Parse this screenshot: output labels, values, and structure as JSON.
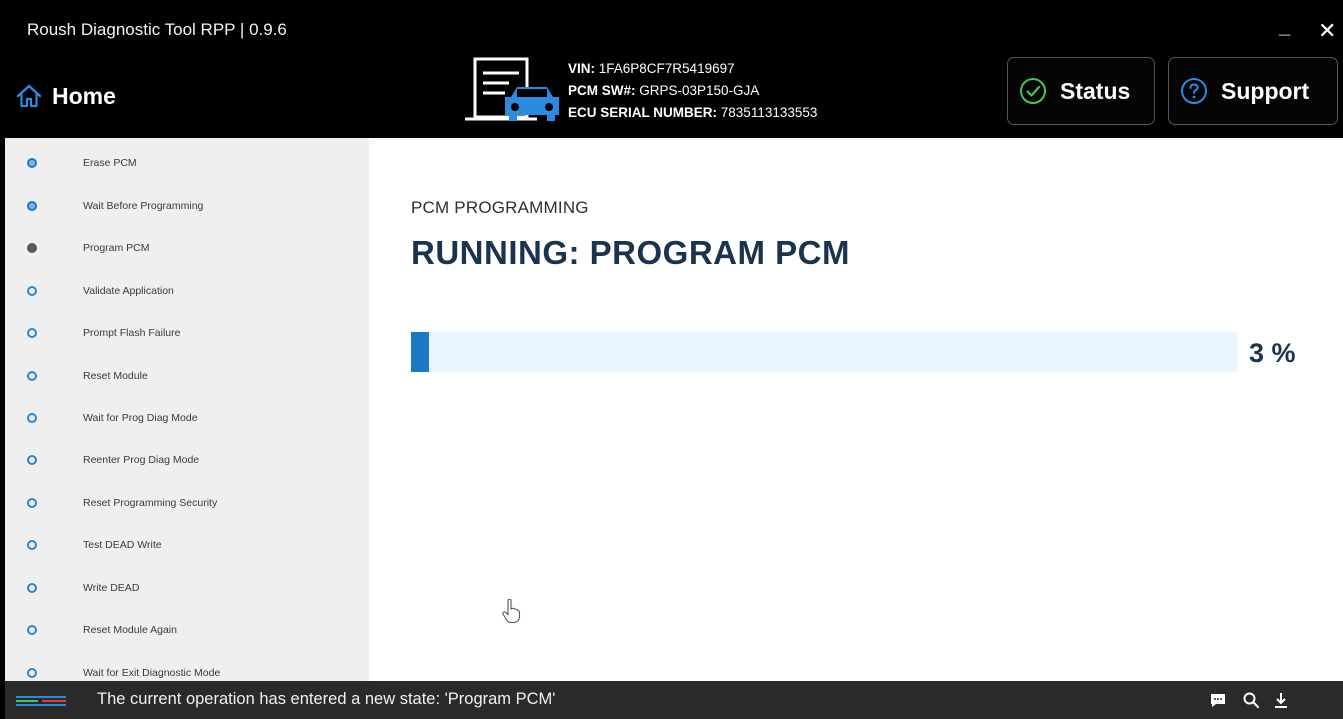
{
  "window": {
    "title": "Roush Diagnostic Tool RPP | 0.9.6",
    "minimize_glyph": "_",
    "close_glyph": "✕"
  },
  "header": {
    "home_label": "Home",
    "vin_label": "VIN:",
    "vin_value": "1FA6P8CF7R5419697",
    "pcm_sw_label": "PCM SW#:",
    "pcm_sw_value": "GRPS-03P150-GJA",
    "ecu_serial_label": "ECU SERIAL NUMBER:",
    "ecu_serial_value": "7835113133553",
    "status_button": "Status",
    "support_button": "Support"
  },
  "sidebar": {
    "steps": [
      {
        "label": "Erase PCM",
        "state": "done"
      },
      {
        "label": "Wait Before Programming",
        "state": "done"
      },
      {
        "label": "Program PCM",
        "state": "current"
      },
      {
        "label": "Validate Application",
        "state": "pending"
      },
      {
        "label": "Prompt Flash Failure",
        "state": "pending"
      },
      {
        "label": "Reset Module",
        "state": "pending"
      },
      {
        "label": "Wait for Prog Diag Mode",
        "state": "pending"
      },
      {
        "label": "Reenter Prog Diag Mode",
        "state": "pending"
      },
      {
        "label": "Reset Programming Security",
        "state": "pending"
      },
      {
        "label": "Test DEAD Write",
        "state": "pending"
      },
      {
        "label": "Write DEAD",
        "state": "pending"
      },
      {
        "label": "Reset Module Again",
        "state": "pending"
      },
      {
        "label": "Wait for Exit Diagnostic Mode",
        "state": "pending"
      }
    ]
  },
  "main": {
    "section_title": "PCM PROGRAMMING",
    "running_title": "RUNNING: PROGRAM PCM",
    "progress_percent": 3,
    "progress_text": "3 %"
  },
  "statusbar": {
    "message": "The current operation has entered a new state: 'Program PCM'",
    "icons": [
      "chat-icon",
      "search-icon",
      "download-icon"
    ]
  },
  "colors": {
    "header_bg": "#000000",
    "accent_blue": "#1e78c8",
    "title_navy": "#1a3450",
    "sidebar_bg": "#efefef",
    "statusbar_bg": "#2a2a2a"
  }
}
